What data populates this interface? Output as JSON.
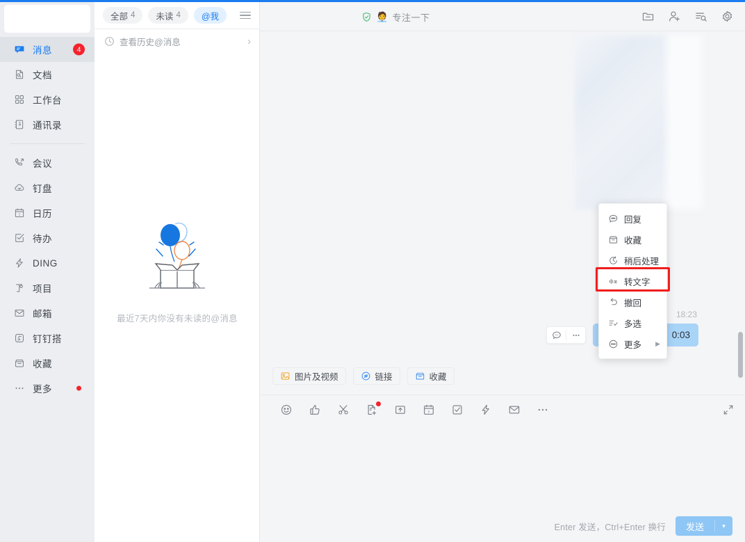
{
  "sidebar": {
    "items": [
      {
        "label": "消息",
        "icon": "message-icon",
        "active": true,
        "badge": "4"
      },
      {
        "label": "文档",
        "icon": "document-icon",
        "active": false,
        "badge": ""
      },
      {
        "label": "工作台",
        "icon": "workbench-icon",
        "active": false,
        "badge": ""
      },
      {
        "label": "通讯录",
        "icon": "contacts-icon",
        "active": false,
        "badge": ""
      },
      {
        "label": "会议",
        "icon": "meeting-icon",
        "active": false,
        "badge": ""
      },
      {
        "label": "钉盘",
        "icon": "cloud-icon",
        "active": false,
        "badge": ""
      },
      {
        "label": "日历",
        "icon": "calendar-icon",
        "active": false,
        "badge": ""
      },
      {
        "label": "待办",
        "icon": "todo-icon",
        "active": false,
        "badge": ""
      },
      {
        "label": "DING",
        "icon": "ding-icon",
        "active": false,
        "badge": ""
      },
      {
        "label": "项目",
        "icon": "project-icon",
        "active": false,
        "badge": ""
      },
      {
        "label": "邮箱",
        "icon": "mail-icon",
        "active": false,
        "badge": ""
      },
      {
        "label": "钉钉搭",
        "icon": "dingtalk-build-icon",
        "active": false,
        "badge": ""
      },
      {
        "label": "收藏",
        "icon": "favorite-icon",
        "active": false,
        "badge": ""
      },
      {
        "label": "更多",
        "icon": "more-dots-icon",
        "active": false,
        "badge": ""
      }
    ]
  },
  "list_panel": {
    "tabs": [
      {
        "label": "全部",
        "count": "4",
        "selected": false
      },
      {
        "label": "未读",
        "count": "4",
        "selected": false
      },
      {
        "label": "@我",
        "count": "",
        "selected": true
      }
    ],
    "history_row": "查看历史@消息",
    "empty_text": "最近7天内你没有未读的@消息"
  },
  "chat": {
    "header": {
      "title": "专注一下",
      "emoji": "🧑‍💼",
      "shield_icon": "shield-check-icon",
      "icons": [
        "folder-icon",
        "add-member-icon",
        "search-chat-icon",
        "settings-gear-icon"
      ]
    },
    "message": {
      "time": "18:23",
      "duration": "0:03",
      "hover_actions": [
        "reply-bubble-icon",
        "more-dots-icon"
      ]
    }
  },
  "context_menu": {
    "items": [
      {
        "label": "回复",
        "icon": "reply-bubble-icon",
        "highlighted": false,
        "submenu": false
      },
      {
        "label": "收藏",
        "icon": "favorite-icon",
        "highlighted": false,
        "submenu": false
      },
      {
        "label": "稍后处理",
        "icon": "clock-icon",
        "highlighted": false,
        "submenu": false
      },
      {
        "label": "转文字",
        "icon": "voice-to-text-icon",
        "highlighted": true,
        "submenu": false
      },
      {
        "label": "撤回",
        "icon": "undo-icon",
        "highlighted": false,
        "submenu": false
      },
      {
        "label": "多选",
        "icon": "multi-select-icon",
        "highlighted": false,
        "submenu": false
      },
      {
        "label": "更多",
        "icon": "more-circle-icon",
        "highlighted": false,
        "submenu": true
      }
    ],
    "highlight_color": "#f01d1d",
    "submenu_arrow": "▶"
  },
  "attach_chips": [
    {
      "label": "图片及视频",
      "icon": "image-icon"
    },
    {
      "label": "链接",
      "icon": "link-icon"
    },
    {
      "label": "收藏",
      "icon": "favorite-icon"
    }
  ],
  "input": {
    "toolbar_icons": [
      "emoji-icon",
      "thumbs-up-icon",
      "scissors-icon",
      "file-add-icon",
      "upload-folder-icon",
      "calendar-icon",
      "todo-check-icon",
      "ding-lightning-icon",
      "mail-icon",
      "more-dots-icon"
    ],
    "expand_icon": "expand-icon",
    "hint": "Enter 发送，Ctrl+Enter 换行",
    "send_label": "发送",
    "send_caret": "▾",
    "value": "",
    "placeholder": ""
  },
  "colors": {
    "accent": "#1a7cf0",
    "badge_red": "#f5222d",
    "bubble_blue": "#a8d4f8",
    "send_blue": "#8ec6f5",
    "sidebar_bg": "#eceef1",
    "chat_bg": "#f4f5f7",
    "highlight_red": "#f01d1d"
  }
}
